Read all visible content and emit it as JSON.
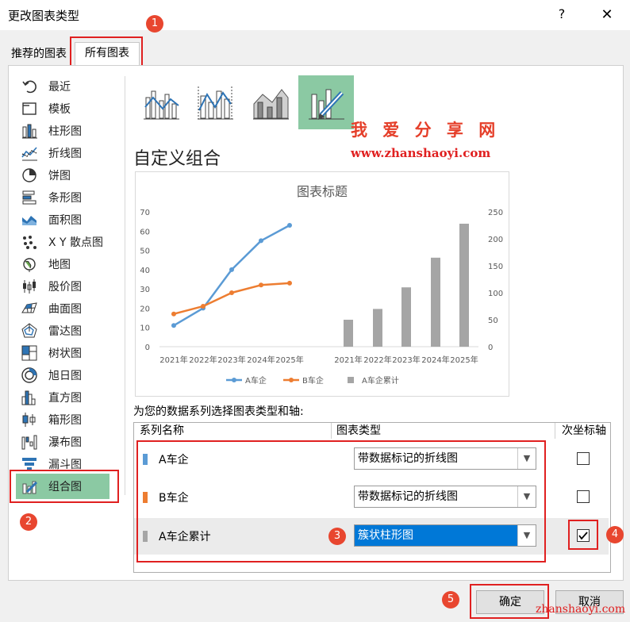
{
  "window": {
    "title": "更改图表类型",
    "help": "?",
    "close": "✕"
  },
  "tabs": {
    "recommended": "推荐的图表",
    "all": "所有图表"
  },
  "badges": [
    "1",
    "2",
    "3",
    "4",
    "5"
  ],
  "sidebar": {
    "items": [
      {
        "label": "最近",
        "icon": "undo-icon"
      },
      {
        "label": "模板",
        "icon": "folder-icon"
      },
      {
        "label": "柱形图",
        "icon": "column-chart-icon"
      },
      {
        "label": "折线图",
        "icon": "line-chart-icon"
      },
      {
        "label": "饼图",
        "icon": "pie-chart-icon"
      },
      {
        "label": "条形图",
        "icon": "bar-chart-icon"
      },
      {
        "label": "面积图",
        "icon": "area-chart-icon"
      },
      {
        "label": "X Y 散点图",
        "icon": "scatter-chart-icon"
      },
      {
        "label": "地图",
        "icon": "map-chart-icon"
      },
      {
        "label": "股价图",
        "icon": "stock-chart-icon"
      },
      {
        "label": "曲面图",
        "icon": "surface-chart-icon"
      },
      {
        "label": "雷达图",
        "icon": "radar-chart-icon"
      },
      {
        "label": "树状图",
        "icon": "treemap-chart-icon"
      },
      {
        "label": "旭日图",
        "icon": "sunburst-chart-icon"
      },
      {
        "label": "直方图",
        "icon": "histogram-chart-icon"
      },
      {
        "label": "箱形图",
        "icon": "boxplot-chart-icon"
      },
      {
        "label": "瀑布图",
        "icon": "waterfall-chart-icon"
      },
      {
        "label": "漏斗图",
        "icon": "funnel-chart-icon"
      },
      {
        "label": "组合图",
        "icon": "combo-chart-icon"
      }
    ],
    "selected": "组合图"
  },
  "main": {
    "heading": "自定义组合"
  },
  "watermark": {
    "line1": "我 爱 分 享 网",
    "line2": "www.zhanshaoyi.com",
    "corner": "zhanshaoyi.com"
  },
  "chart_data": {
    "type": "combo",
    "title": "图表标题",
    "categories": [
      "2021年",
      "2022年",
      "2023年",
      "2024年",
      "2025年"
    ],
    "y_left": {
      "ylim": [
        0,
        70
      ],
      "ticks": [
        0,
        10,
        20,
        30,
        40,
        50,
        60,
        70
      ]
    },
    "y_right": {
      "ylim": [
        0,
        250
      ],
      "ticks": [
        0,
        50,
        100,
        150,
        200,
        250
      ]
    },
    "series": [
      {
        "name": "A车企",
        "type": "line-markers",
        "axis": "primary",
        "color": "#5b9bd5",
        "values": [
          11,
          20,
          40,
          55,
          63
        ]
      },
      {
        "name": "B车企",
        "type": "line-markers",
        "axis": "primary",
        "color": "#ed7d31",
        "values": [
          17,
          21,
          28,
          32,
          33
        ]
      },
      {
        "name": "A车企累计",
        "type": "bar",
        "axis": "secondary",
        "color": "#a5a5a5",
        "values": [
          50,
          70,
          110,
          165,
          228
        ]
      }
    ],
    "legend_position": "bottom"
  },
  "series_panel": {
    "label": "为您的数据系列选择图表类型和轴:",
    "columns": {
      "name": "系列名称",
      "type": "图表类型",
      "secondary": "次坐标轴"
    },
    "rows": [
      {
        "name": "A车企",
        "type": "带数据标记的折线图",
        "secondary": false,
        "color": "#5b9bd5"
      },
      {
        "name": "B车企",
        "type": "带数据标记的折线图",
        "secondary": false,
        "color": "#ed7d31"
      },
      {
        "name": "A车企累计",
        "type": "簇状柱形图",
        "secondary": true,
        "color": "#a5a5a5"
      }
    ]
  },
  "buttons": {
    "ok": "确定",
    "cancel": "取消"
  }
}
